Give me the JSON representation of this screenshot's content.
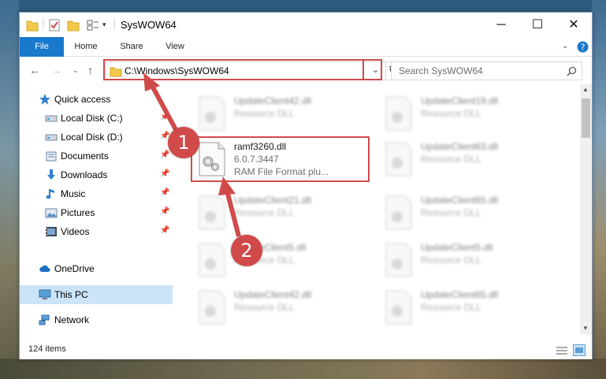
{
  "window": {
    "title": "SysWOW64",
    "controls": {
      "minimize": "─",
      "maximize": "☐",
      "close": "✕"
    }
  },
  "ribbon": {
    "tabs": [
      "File",
      "Home",
      "Share",
      "View"
    ],
    "help_icon": "help-icon"
  },
  "address_bar": {
    "path": "C:\\Windows\\SysWOW64"
  },
  "search": {
    "placeholder": "Search SysWOW64"
  },
  "sidebar": {
    "items": [
      {
        "label": "Quick access",
        "icon": "star-icon",
        "pinned": false
      },
      {
        "label": "Local Disk (C:)",
        "icon": "drive-icon",
        "pinned": true
      },
      {
        "label": "Local Disk (D:)",
        "icon": "drive-icon",
        "pinned": true
      },
      {
        "label": "Documents",
        "icon": "documents-icon",
        "pinned": true
      },
      {
        "label": "Downloads",
        "icon": "download-icon",
        "pinned": true
      },
      {
        "label": "Music",
        "icon": "music-icon",
        "pinned": true
      },
      {
        "label": "Pictures",
        "icon": "pictures-icon",
        "pinned": true
      },
      {
        "label": "Videos",
        "icon": "videos-icon",
        "pinned": true
      },
      {
        "label": "OneDrive",
        "icon": "cloud-icon",
        "pinned": false
      },
      {
        "label": "This PC",
        "icon": "computer-icon",
        "pinned": false,
        "selected": true
      },
      {
        "label": "Network",
        "icon": "network-icon",
        "pinned": false
      }
    ]
  },
  "files": {
    "highlighted": {
      "name": "ramf3260.dll",
      "version": "6.0.7.3447",
      "description": "RAM File Format plu..."
    },
    "blurred": [
      {
        "name": "UpdateClient42.dll",
        "description": "Resource DLL"
      },
      {
        "name": "UpdateClient19.dll",
        "description": "Resource DLL"
      },
      {
        "name": "UpdateClient63.dll",
        "description": "Resource DLL"
      },
      {
        "name": "UpdateClient21.dll",
        "description": "Resource DLL"
      },
      {
        "name": "UpdateClient65.dll",
        "description": "Resource DLL"
      },
      {
        "name": "UpdateClient5.dll",
        "description": "Resource DLL"
      },
      {
        "name": "UpdateClient5.dll",
        "description": "Resource DLL"
      },
      {
        "name": "UpdateClient42.dll",
        "description": "Resource DLL"
      },
      {
        "name": "UpdateClient65.dll",
        "description": "Resource DLL"
      }
    ]
  },
  "status": {
    "item_count": "124 items"
  },
  "annotations": {
    "step1": "1",
    "step2": "2"
  },
  "colors": {
    "accent": "#1979ca",
    "annotation": "#d04a4a",
    "selected": "#cce4f7"
  }
}
